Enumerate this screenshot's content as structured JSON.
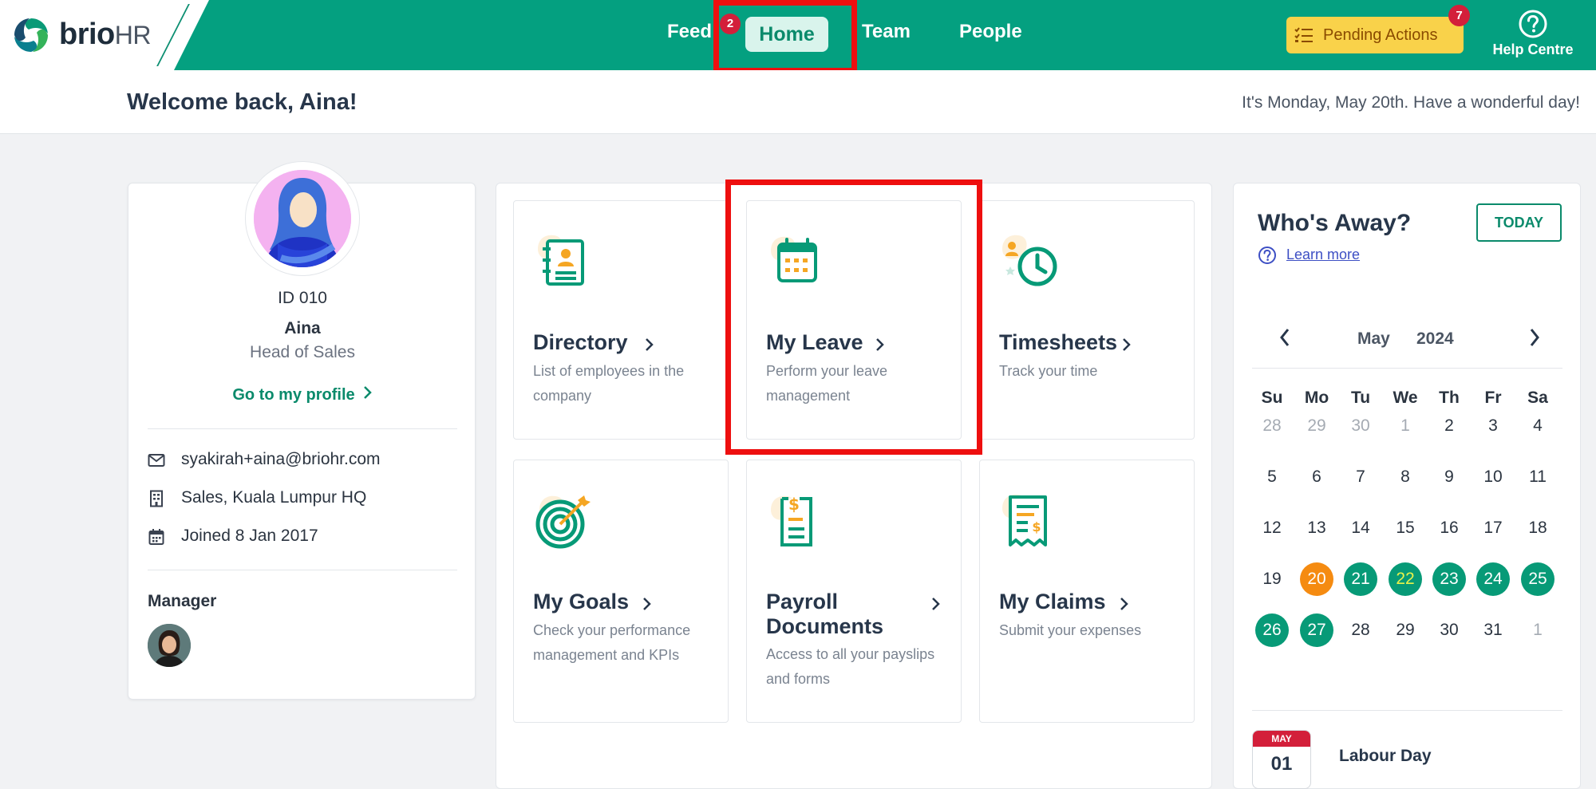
{
  "brand": {
    "name": "brio",
    "suffix": "HR"
  },
  "nav": {
    "feed": "Feed",
    "feed_badge": "2",
    "home": "Home",
    "team": "Team",
    "people": "People"
  },
  "header_actions": {
    "pending_label": "Pending Actions",
    "pending_badge": "7",
    "help_label": "Help Centre"
  },
  "welcome": {
    "title": "Welcome back, Aina!",
    "date_line": "It's Monday, May 20th. Have a wonderful day!"
  },
  "profile": {
    "id": "ID 010",
    "name": "Aina",
    "role": "Head of Sales",
    "link": "Go to my profile",
    "email": "syakirah+aina@briohr.com",
    "location": "Sales, Kuala Lumpur HQ",
    "joined": "Joined 8 Jan 2017",
    "manager_label": "Manager"
  },
  "tiles": [
    {
      "title": "Directory",
      "desc": "List of employees in the company",
      "icon": "directory-icon"
    },
    {
      "title": "My Leave",
      "desc": "Perform your leave management",
      "icon": "calendar-icon"
    },
    {
      "title": "Timesheets",
      "desc": "Track your time",
      "icon": "clock-icon"
    },
    {
      "title": "My Goals",
      "desc": "Check your performance management and KPIs",
      "icon": "target-icon"
    },
    {
      "title": "Payroll Documents",
      "desc": "Access to all your payslips and forms",
      "icon": "payslip-icon"
    },
    {
      "title": "My Claims",
      "desc": "Submit your expenses",
      "icon": "receipt-icon"
    }
  ],
  "away": {
    "title": "Who's Away?",
    "today_button": "TODAY",
    "learn_more": "Learn more",
    "month": "May",
    "year": "2024",
    "weekdays": [
      "Su",
      "Mo",
      "Tu",
      "We",
      "Th",
      "Fr",
      "Sa"
    ],
    "weeks": [
      [
        "28",
        "29",
        "30",
        "1",
        "2",
        "3",
        "4"
      ],
      [
        "5",
        "6",
        "7",
        "8",
        "9",
        "10",
        "11"
      ],
      [
        "12",
        "13",
        "14",
        "15",
        "16",
        "17",
        "18"
      ],
      [
        "19",
        "20",
        "21",
        "22",
        "23",
        "24",
        "25"
      ],
      [
        "26",
        "27",
        "28",
        "29",
        "30",
        "31",
        "1"
      ]
    ],
    "holiday": {
      "month": "MAY",
      "day": "01",
      "name": "Labour Day"
    }
  },
  "colors": {
    "brand_green": "#04a080",
    "pending_yellow": "#f9d24a",
    "badge_red": "#d31f3a",
    "today_orange": "#f58b11",
    "highlight_red": "#ee0f0f"
  }
}
